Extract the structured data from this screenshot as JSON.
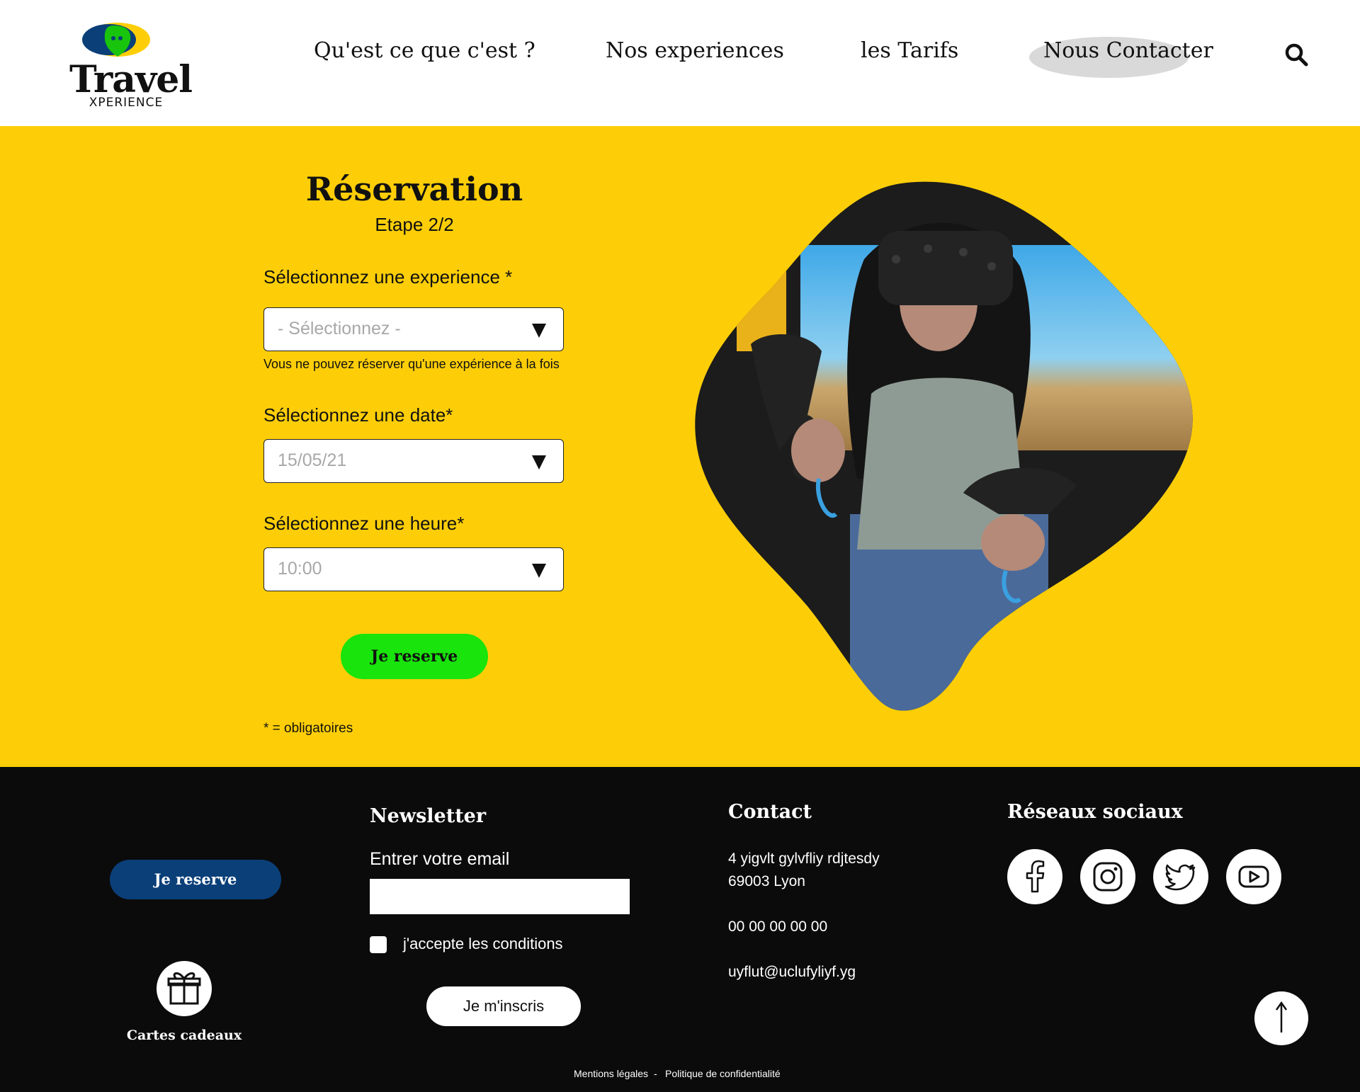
{
  "header": {
    "logo": {
      "word": "Travel",
      "sub": "XPERIENCE"
    },
    "nav": [
      {
        "label": "Qu'est ce que c'est ?"
      },
      {
        "label": "Nos experiences"
      },
      {
        "label": "les Tarifs"
      },
      {
        "label": "Nous Contacter"
      }
    ],
    "search_icon": "search-icon"
  },
  "reservation": {
    "title": "Réservation",
    "step": "Etape 2/2",
    "experience": {
      "label": "Sélectionnez une experience *",
      "value": "- Sélectionnez -",
      "hint": "Vous ne pouvez réserver qu'une expérience à la fois"
    },
    "date": {
      "label": "Sélectionnez une date*",
      "value": "15/05/21"
    },
    "time": {
      "label": "Sélectionnez une heure*",
      "value": "10:00"
    },
    "submit_label": "Je reserve",
    "required_note": "* = obligatoires"
  },
  "footer": {
    "reserve_label": "Je reserve",
    "gift_label": "Cartes cadeaux",
    "newsletter": {
      "title": "Newsletter",
      "email_label": "Entrer votre email",
      "email_value": "",
      "accept_label": "j'accepte les conditions",
      "submit_label": "Je m'inscris"
    },
    "contact": {
      "title": "Contact",
      "address_line1": "4 yigvlt gylvfliy rdjtesdy",
      "address_line2": "69003 Lyon",
      "phone": "00 00 00 00 00",
      "email": "uyflut@uclufyliyf.yg"
    },
    "social": {
      "title": "Réseaux sociaux",
      "icons": [
        "facebook-icon",
        "instagram-icon",
        "twitter-icon",
        "youtube-icon"
      ]
    },
    "legal": {
      "mentions": "Mentions légales",
      "separator": "-",
      "privacy": "Politique de confidentialité"
    }
  },
  "colors": {
    "yellow": "#fdce08",
    "green_button": "#19e40c",
    "blue_button": "#0a3f78",
    "footer_bg": "#0b0b0b"
  }
}
